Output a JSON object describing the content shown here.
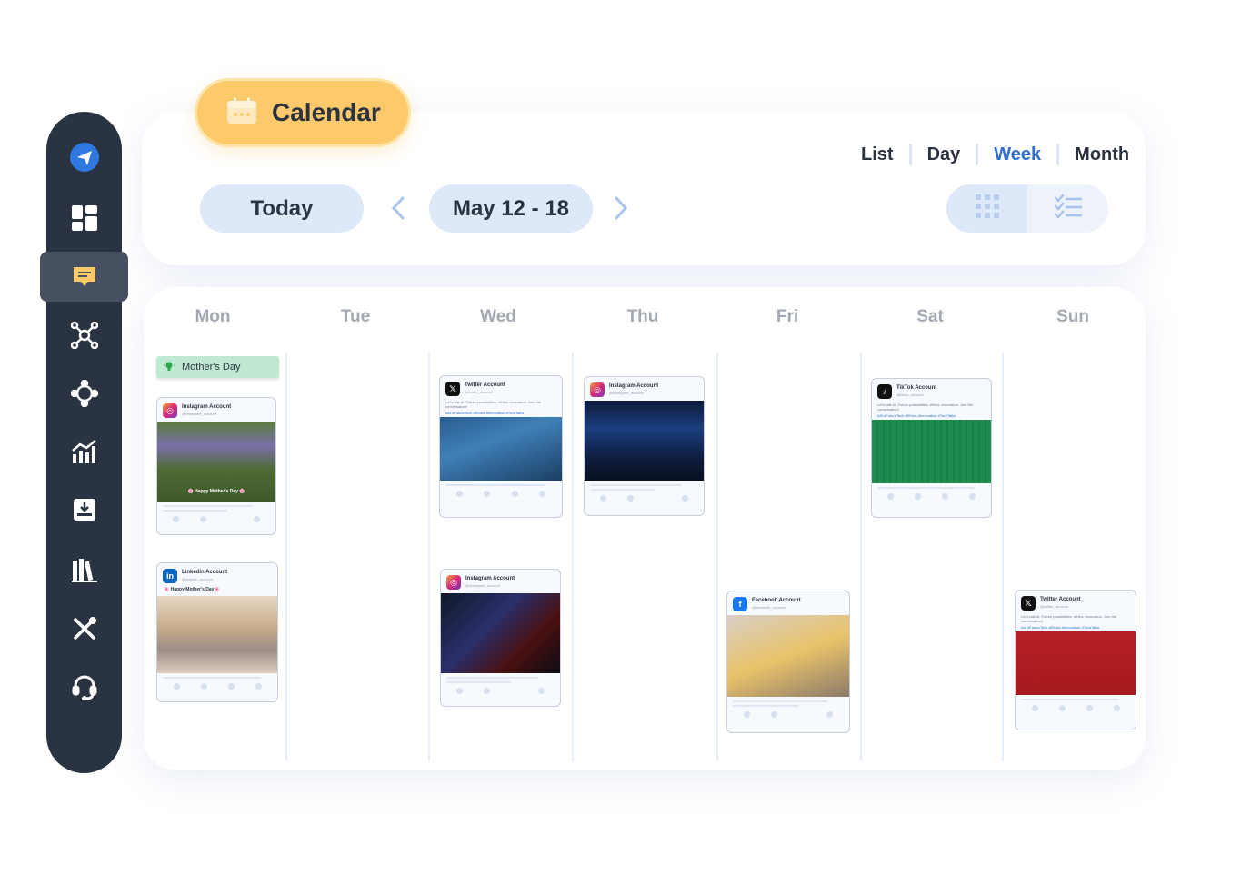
{
  "header": {
    "title": "Calendar",
    "today_label": "Today",
    "date_range": "May 12 - 18",
    "views": [
      "List",
      "Day",
      "Week",
      "Month"
    ],
    "active_view": "Week"
  },
  "colors": {
    "sidebar": "#2a3342",
    "accent_blue": "#2f6fd6",
    "calendar_pill": "#fcc96b",
    "button_bg": "#dde8f8",
    "event_green": "#bfe9d3"
  },
  "sidebar": {
    "items": [
      {
        "icon": "send-icon"
      },
      {
        "icon": "dashboard-icon"
      },
      {
        "icon": "message-icon",
        "active": true
      },
      {
        "icon": "network-icon"
      },
      {
        "icon": "integrations-icon"
      },
      {
        "icon": "analytics-icon"
      },
      {
        "icon": "inbox-download-icon"
      },
      {
        "icon": "library-icon"
      },
      {
        "icon": "tools-icon"
      },
      {
        "icon": "support-headset-icon"
      }
    ]
  },
  "days": [
    "Mon",
    "Tue",
    "Wed",
    "Thu",
    "Fri",
    "Sat",
    "Sun"
  ],
  "event": {
    "label": "Mother's Day",
    "icon": "bulb-icon"
  },
  "posts": {
    "mon_instagram": {
      "account": "Instagram Account",
      "handle": "@instagram_account",
      "caption": "🌸 Happy Mother's Day 🌸"
    },
    "mon_linkedin": {
      "account": "Linkedin Account",
      "handle": "@linkedin_account",
      "caption": "🌸 Happy Mother's Day🌸"
    },
    "wed_twitter": {
      "account": "Twitter Account",
      "handle": "@twitter_account",
      "message": "Let's talk AI: Future possibilities, ethics, innovation. Join the conversation!",
      "tags": "#AI #FutureTech #Ethics #Innovation #TechTalks"
    },
    "wed_instagram": {
      "account": "Instagram Account",
      "handle": "@instagram_account"
    },
    "thu_instagram": {
      "account": "Instagram Account",
      "handle": "@instagram_account"
    },
    "fri_facebook": {
      "account": "Facebook Account",
      "handle": "@facebook_account"
    },
    "sat_tiktok": {
      "account": "TikTok Account",
      "handle": "@tiktok_account",
      "message": "Let's talk AI: Future possibilities, ethics, innovation. Join the conversation!",
      "tags": "#AI #FutureTech #Ethics #Innovation #TechTalks"
    },
    "sun_twitter": {
      "account": "Twitter Account",
      "handle": "@twitter_account",
      "message": "Let's talk AI: Future possibilities, ethics, innovation. Join the conversation!",
      "tags": "#AI #FutureTech #Ethics #Innovation #TechTalks"
    }
  }
}
